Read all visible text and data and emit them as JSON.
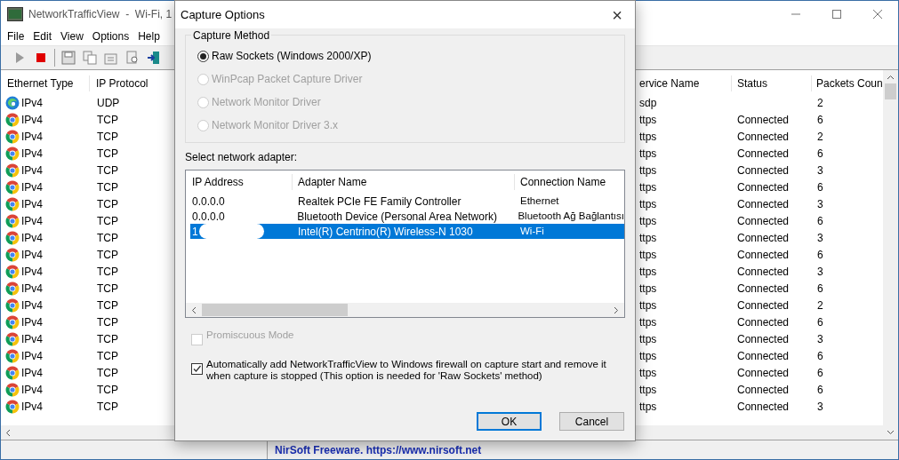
{
  "main_window": {
    "title": "NetworkTrafficView  -  Wi-Fi, 1",
    "menu": [
      "File",
      "Edit",
      "View",
      "Options",
      "Help"
    ],
    "table": {
      "columns": [
        "Ethernet Type",
        "IP Protocol",
        "ervice Name",
        "Status",
        "Packets Coun"
      ],
      "rows": [
        {
          "kind": "edge",
          "ethernet_type": "IPv4",
          "ip_protocol": "UDP",
          "service": "sdp",
          "status": "",
          "packets": "2"
        },
        {
          "kind": "chrome",
          "ethernet_type": "IPv4",
          "ip_protocol": "TCP",
          "service": "ttps",
          "status": "Connected",
          "packets": "6"
        },
        {
          "kind": "chrome",
          "ethernet_type": "IPv4",
          "ip_protocol": "TCP",
          "service": "ttps",
          "status": "Connected",
          "packets": "2"
        },
        {
          "kind": "chrome",
          "ethernet_type": "IPv4",
          "ip_protocol": "TCP",
          "service": "ttps",
          "status": "Connected",
          "packets": "6"
        },
        {
          "kind": "chrome",
          "ethernet_type": "IPv4",
          "ip_protocol": "TCP",
          "service": "ttps",
          "status": "Connected",
          "packets": "3"
        },
        {
          "kind": "chrome",
          "ethernet_type": "IPv4",
          "ip_protocol": "TCP",
          "service": "ttps",
          "status": "Connected",
          "packets": "6"
        },
        {
          "kind": "chrome",
          "ethernet_type": "IPv4",
          "ip_protocol": "TCP",
          "service": "ttps",
          "status": "Connected",
          "packets": "3"
        },
        {
          "kind": "chrome",
          "ethernet_type": "IPv4",
          "ip_protocol": "TCP",
          "service": "ttps",
          "status": "Connected",
          "packets": "6"
        },
        {
          "kind": "chrome",
          "ethernet_type": "IPv4",
          "ip_protocol": "TCP",
          "service": "ttps",
          "status": "Connected",
          "packets": "3"
        },
        {
          "kind": "chrome",
          "ethernet_type": "IPv4",
          "ip_protocol": "TCP",
          "service": "ttps",
          "status": "Connected",
          "packets": "6"
        },
        {
          "kind": "chrome",
          "ethernet_type": "IPv4",
          "ip_protocol": "TCP",
          "service": "ttps",
          "status": "Connected",
          "packets": "3"
        },
        {
          "kind": "chrome",
          "ethernet_type": "IPv4",
          "ip_protocol": "TCP",
          "service": "ttps",
          "status": "Connected",
          "packets": "6"
        },
        {
          "kind": "chrome",
          "ethernet_type": "IPv4",
          "ip_protocol": "TCP",
          "service": "ttps",
          "status": "Connected",
          "packets": "2"
        },
        {
          "kind": "chrome",
          "ethernet_type": "IPv4",
          "ip_protocol": "TCP",
          "service": "ttps",
          "status": "Connected",
          "packets": "6"
        },
        {
          "kind": "chrome",
          "ethernet_type": "IPv4",
          "ip_protocol": "TCP",
          "service": "ttps",
          "status": "Connected",
          "packets": "3"
        },
        {
          "kind": "chrome",
          "ethernet_type": "IPv4",
          "ip_protocol": "TCP",
          "service": "ttps",
          "status": "Connected",
          "packets": "6"
        },
        {
          "kind": "chrome",
          "ethernet_type": "IPv4",
          "ip_protocol": "TCP",
          "service": "ttps",
          "status": "Connected",
          "packets": "6"
        },
        {
          "kind": "chrome",
          "ethernet_type": "IPv4",
          "ip_protocol": "TCP",
          "service": "ttps",
          "status": "Connected",
          "packets": "6"
        },
        {
          "kind": "chrome",
          "ethernet_type": "IPv4",
          "ip_protocol": "TCP",
          "service": "ttps",
          "status": "Connected",
          "packets": "3"
        }
      ]
    },
    "status_bar": "NirSoft Freeware. https://www.nirsoft.net"
  },
  "dialog": {
    "title": "Capture Options",
    "close": "×",
    "capture_method": {
      "label": "Capture Method",
      "options": [
        {
          "label": "Raw Sockets (Windows 2000/XP)",
          "selected": true,
          "disabled": false
        },
        {
          "label": "WinPcap Packet Capture Driver",
          "selected": false,
          "disabled": true
        },
        {
          "label": "Network Monitor Driver",
          "selected": false,
          "disabled": true
        },
        {
          "label": "Network Monitor Driver 3.x",
          "selected": false,
          "disabled": true
        }
      ]
    },
    "adapter_label": "Select network adapter:",
    "adapters": {
      "columns": [
        "IP Address",
        "Adapter Name",
        "Connection Name"
      ],
      "rows": [
        {
          "ip": "0.0.0.0",
          "adapter": "Realtek PCIe FE Family Controller",
          "connection": "Ethernet",
          "selected": false
        },
        {
          "ip": "0.0.0.0",
          "adapter": "Bluetooth Device (Personal Area Network)",
          "connection": "Bluetooth Ağ Bağlantısı",
          "selected": false
        },
        {
          "ip": "1",
          "adapter": "Intel(R) Centrino(R) Wireless-N 1030",
          "connection": "Wi-Fi",
          "selected": true
        }
      ]
    },
    "checkboxes": [
      {
        "label": "Promiscuous Mode",
        "checked": false,
        "disabled": true
      },
      {
        "label": "Automatically add NetworkTrafficView to Windows firewall on capture start and remove it when capture is stopped (This option is needed for 'Raw Sockets' method)",
        "checked": true,
        "disabled": false
      }
    ],
    "buttons": [
      {
        "label": "OK",
        "default": true
      },
      {
        "label": "Cancel",
        "default": false
      }
    ]
  }
}
